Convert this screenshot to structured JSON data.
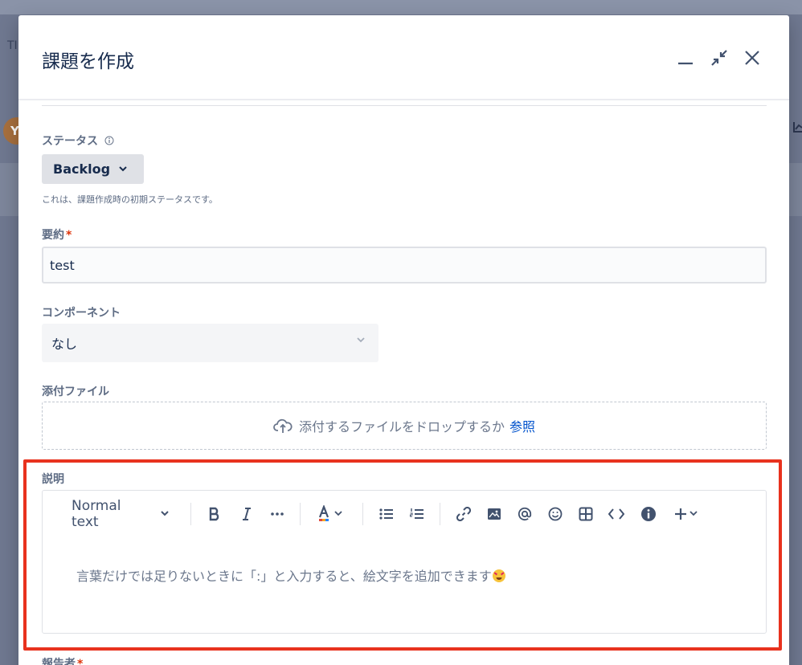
{
  "background": {
    "title_fragment": "TI",
    "avatar_letter": "Y"
  },
  "modal": {
    "title": "課題を作成"
  },
  "status": {
    "label": "ステータス",
    "value": "Backlog",
    "helper": "これは、課題作成時の初期ステータスです。"
  },
  "summary": {
    "label": "要約",
    "required_mark": "*",
    "value": "test"
  },
  "component": {
    "label": "コンポーネント",
    "value": "なし"
  },
  "attachment": {
    "label": "添付ファイル",
    "drop_text": "添付するファイルをドロップするか",
    "browse_link": "参照"
  },
  "description": {
    "label": "説明",
    "text_style": "Normal text",
    "placeholder": "言葉だけでは足りないときに「:」と入力すると、絵文字を追加できます"
  },
  "reporter": {
    "label": "報告者",
    "required_mark": "*"
  },
  "colors": {
    "highlight": "#e8321e",
    "link": "#0052cc",
    "required": "#de350b"
  }
}
